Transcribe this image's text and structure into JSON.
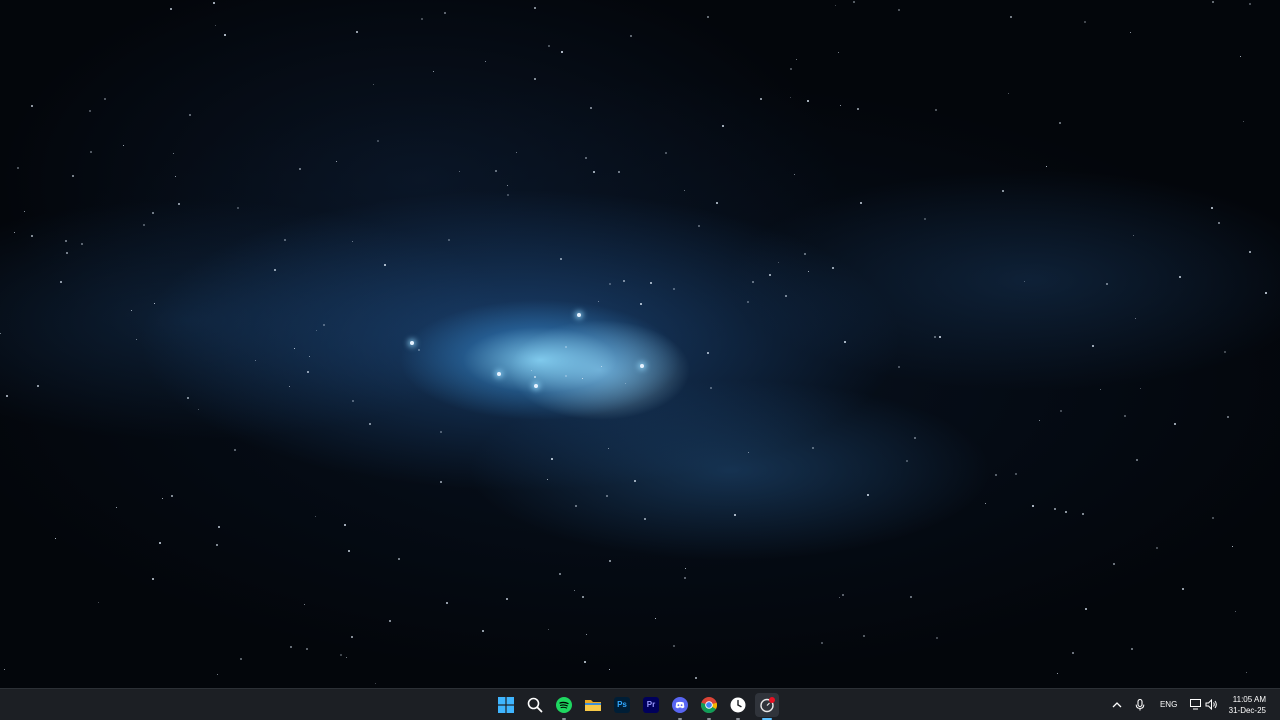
{
  "desktop": {
    "wallpaper": "blue space nebula with stars"
  },
  "taskbar": {
    "background": "#1c1f24",
    "pinned_apps": [
      {
        "name": "Start",
        "icon": "windows-logo-icon",
        "running": false
      },
      {
        "name": "Search",
        "icon": "search-icon",
        "running": false
      },
      {
        "name": "Spotify",
        "icon": "spotify-icon",
        "running": true,
        "color": "#1ed760"
      },
      {
        "name": "File Explorer",
        "icon": "folder-icon",
        "running": false,
        "color": "#f5c542"
      },
      {
        "name": "Photoshop",
        "icon": "photoshop-icon",
        "label": "Ps",
        "running": false,
        "color": "#31a8ff"
      },
      {
        "name": "Premiere Pro",
        "icon": "premiere-icon",
        "label": "Pr",
        "running": false,
        "color": "#9999ff"
      },
      {
        "name": "Discord",
        "icon": "discord-icon",
        "running": true,
        "color": "#5865f2"
      },
      {
        "name": "Chrome",
        "icon": "chrome-icon",
        "running": true
      },
      {
        "name": "Clock",
        "icon": "clock-icon",
        "running": true
      },
      {
        "name": "App",
        "icon": "app-icon",
        "running": true,
        "active": true
      }
    ],
    "tray": {
      "overflow_icon": "chevron-up-icon",
      "mic_icon": "microphone-icon",
      "language": "ENG",
      "network_icon": "network-icon",
      "volume_icon": "volume-icon",
      "time": "11:05 AM",
      "date": "31-Dec-25"
    }
  }
}
